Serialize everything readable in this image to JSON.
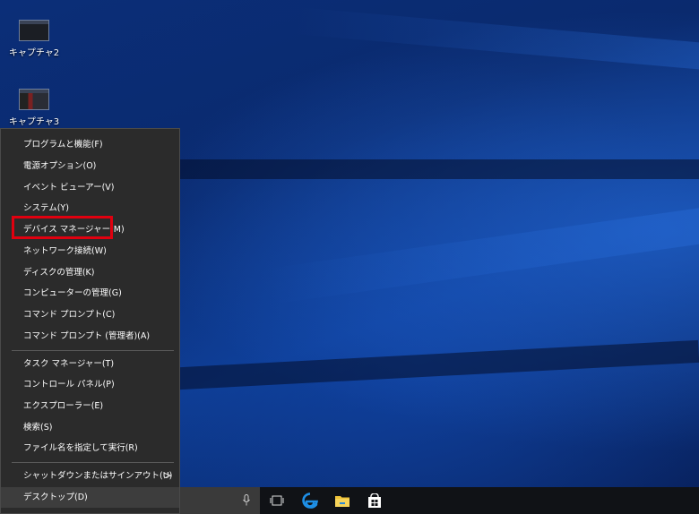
{
  "desktop_icons": [
    {
      "label": "キャプチャ2"
    },
    {
      "label": "キャプチャ3"
    }
  ],
  "menu": {
    "groups": [
      [
        "プログラムと機能(F)",
        "電源オプション(O)",
        "イベント ビューアー(V)",
        "システム(Y)",
        "デバイス マネージャー(M)",
        "ネットワーク接続(W)",
        "ディスクの管理(K)",
        "コンピューターの管理(G)",
        "コマンド プロンプト(C)",
        "コマンド プロンプト (管理者)(A)"
      ],
      [
        "タスク マネージャー(T)",
        "コントロール パネル(P)",
        "エクスプローラー(E)",
        "検索(S)",
        "ファイル名を指定して実行(R)"
      ],
      [
        "シャットダウンまたはサインアウト(U)",
        "デスクトップ(D)"
      ]
    ],
    "highlighted_item": "デバイス マネージャー(M)",
    "submenu_arrow": ">"
  },
  "taskbar": {
    "icons": [
      "microphone-icon",
      "task-view-icon",
      "edge-icon",
      "file-explorer-icon",
      "store-icon"
    ]
  },
  "colors": {
    "menu_bg": "#2b2b2b",
    "highlight_border": "#e0000f",
    "edge_blue": "#1e8fe6",
    "folder_yellow": "#f0c43a"
  }
}
